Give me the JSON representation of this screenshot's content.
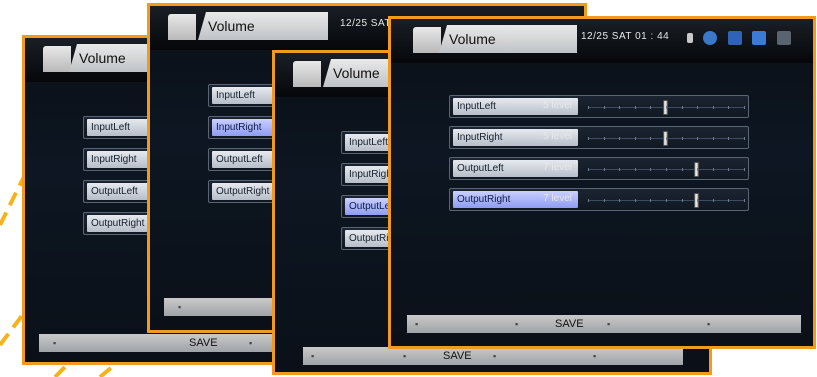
{
  "screens": [
    {
      "title": "Volume",
      "datetime": "",
      "rows": [
        {
          "label": "InputLeft",
          "level": ""
        },
        {
          "label": "InputRight",
          "level": ""
        },
        {
          "label": "OutputLeft",
          "level": ""
        },
        {
          "label": "OutputRight",
          "level": ""
        }
      ],
      "footer": {
        "save": "SAVE"
      }
    },
    {
      "title": "Volume",
      "datetime": "12/25 SAT",
      "rows": [
        {
          "label": "InputLeft",
          "level": ""
        },
        {
          "label": "InputRight",
          "level": ""
        },
        {
          "label": "OutputLeft",
          "level": ""
        },
        {
          "label": "OutputRight",
          "level": ""
        }
      ],
      "footer": {
        "save": ""
      }
    },
    {
      "title": "Volume",
      "datetime": "",
      "rows": [
        {
          "label": "InputLeft",
          "level": ""
        },
        {
          "label": "InputRight",
          "level": ""
        },
        {
          "label": "OutputLeft",
          "level": ""
        },
        {
          "label": "OutputRight",
          "level": ""
        }
      ],
      "footer": {
        "save": "SAVE"
      }
    },
    {
      "title": "Volume",
      "datetime": "12/25  SAT  01 : 44",
      "rows": [
        {
          "label": "InputLeft",
          "level": "5  level",
          "value": 5
        },
        {
          "label": "InputRight",
          "level": "5  level",
          "value": 5
        },
        {
          "label": "OutputLeft",
          "level": "7  level",
          "value": 7
        },
        {
          "label": "OutputRight",
          "level": "7  level",
          "value": 7
        }
      ],
      "footer": {
        "save": "SAVE"
      }
    }
  ],
  "status_icons": [
    "lock-icon",
    "disc-icon",
    "monitor-icon",
    "network-icon",
    "flag-icon"
  ],
  "accent_color": "#f29a1b",
  "selected_color": "#8f9cf1"
}
